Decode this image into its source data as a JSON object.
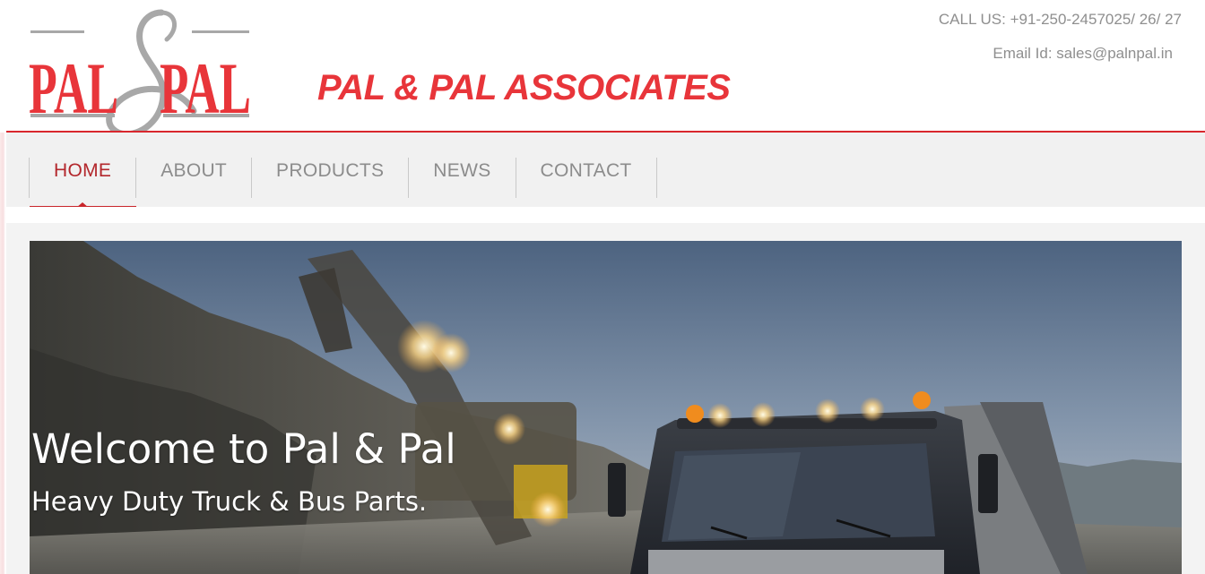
{
  "header": {
    "logo": {
      "left_word": "PAL",
      "ampersand": "&",
      "right_word": "PAL"
    },
    "company_name": "PAL & PAL ASSOCIATES",
    "phone": "CALL US: +91-250-2457025/ 26/ 27",
    "email": "Email Id: sales@palnpal.in"
  },
  "nav": {
    "items": [
      {
        "label": "HOME",
        "active": true
      },
      {
        "label": "ABOUT",
        "active": false
      },
      {
        "label": "PRODUCTS",
        "active": false
      },
      {
        "label": "NEWS",
        "active": false
      },
      {
        "label": "CONTACT",
        "active": false
      }
    ]
  },
  "hero": {
    "title": "Welcome to Pal & Pal",
    "subtitle": "Heavy Duty Truck & Bus Parts.",
    "image": "truck-and-excavator-photo"
  },
  "colors": {
    "brand_red": "#e8353a",
    "nav_active": "#b3272c",
    "nav_text": "#8c8c8c",
    "contact_text": "#8f8f8f"
  }
}
